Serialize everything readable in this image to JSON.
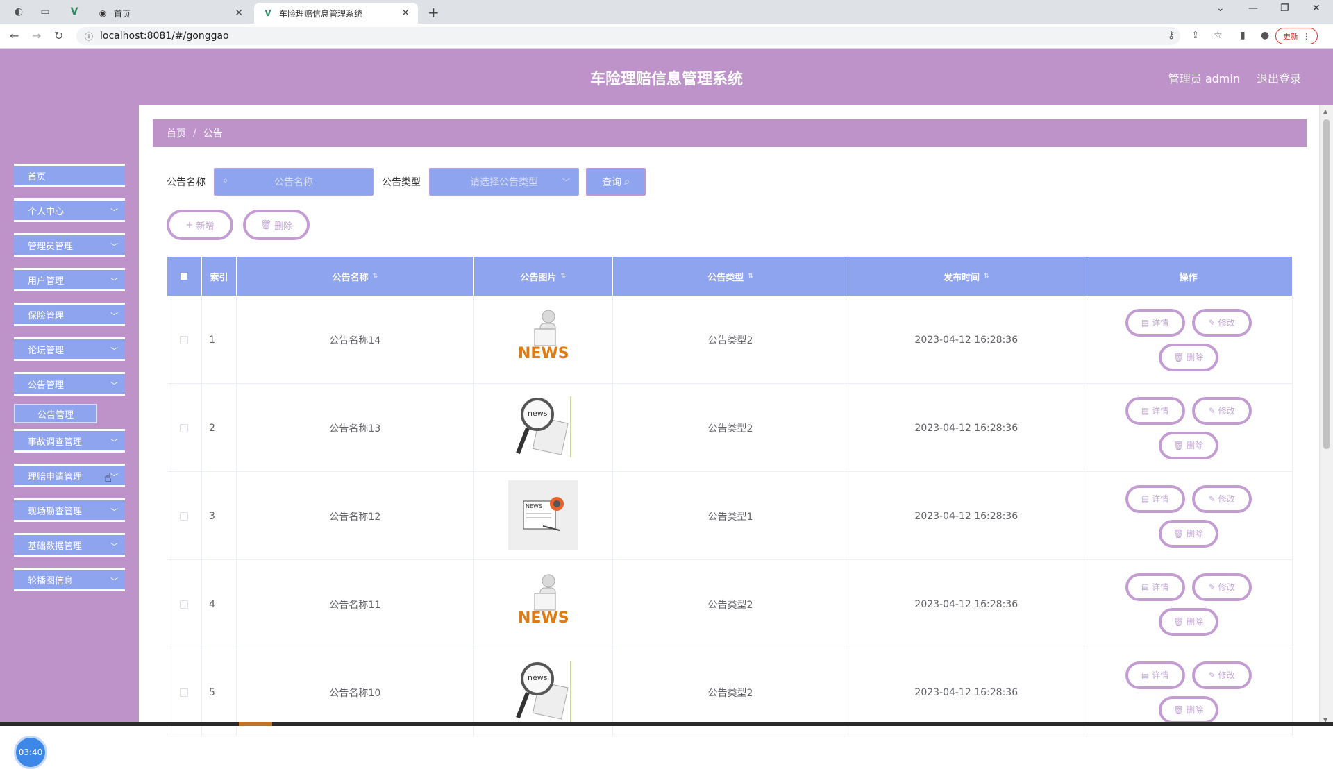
{
  "browser": {
    "tabs": [
      {
        "label": "首页"
      },
      {
        "label": "车险理赔信息管理系统"
      }
    ],
    "url": "localhost:8081/#/gonggao",
    "update_label": "更新"
  },
  "header": {
    "title": "车险理赔信息管理系统",
    "user_label": "管理员 admin",
    "logout_label": "退出登录"
  },
  "sidebar": {
    "items": [
      {
        "label": "首页"
      },
      {
        "label": "个人中心"
      },
      {
        "label": "管理员管理"
      },
      {
        "label": "用户管理"
      },
      {
        "label": "保险管理"
      },
      {
        "label": "论坛管理"
      },
      {
        "label": "公告管理"
      },
      {
        "label": "事故调查管理"
      },
      {
        "label": "理赔申请管理"
      },
      {
        "label": "现场勘查管理"
      },
      {
        "label": "基础数据管理"
      },
      {
        "label": "轮播图信息"
      }
    ],
    "submenu_label": "公告管理",
    "clock": "03:40"
  },
  "breadcrumb": {
    "home": "首页",
    "current": "公告"
  },
  "search": {
    "name_label": "公告名称",
    "name_placeholder": "公告名称",
    "type_label": "公告类型",
    "type_placeholder": "请选择公告类型",
    "query_label": "查询"
  },
  "actions": {
    "add_label": "新增",
    "delete_label": "删除"
  },
  "table": {
    "headers": {
      "index": "索引",
      "name": "公告名称",
      "image": "公告图片",
      "type": "公告类型",
      "time": "发布时间",
      "ops": "操作"
    },
    "op_labels": {
      "detail": "详情",
      "edit": "修改",
      "delete": "删除"
    },
    "rows": [
      {
        "index": "1",
        "name": "公告名称14",
        "image": "news-man-image",
        "type": "公告类型2",
        "time": "2023-04-12 16:28:36"
      },
      {
        "index": "2",
        "name": "公告名称13",
        "image": "news-magnifier-image",
        "type": "公告类型2",
        "time": "2023-04-12 16:28:36"
      },
      {
        "index": "3",
        "name": "公告名称12",
        "image": "news-paper-image",
        "type": "公告类型1",
        "time": "2023-04-12 16:28:36"
      },
      {
        "index": "4",
        "name": "公告名称11",
        "image": "news-man-image",
        "type": "公告类型2",
        "time": "2023-04-12 16:28:36"
      },
      {
        "index": "5",
        "name": "公告名称10",
        "image": "news-magnifier-image",
        "type": "公告类型2",
        "time": "2023-04-12 16:28:36"
      }
    ]
  },
  "colors": {
    "header": "#bd93c9",
    "accent": "#8fa4ee",
    "button_border": "#c39dd2"
  }
}
